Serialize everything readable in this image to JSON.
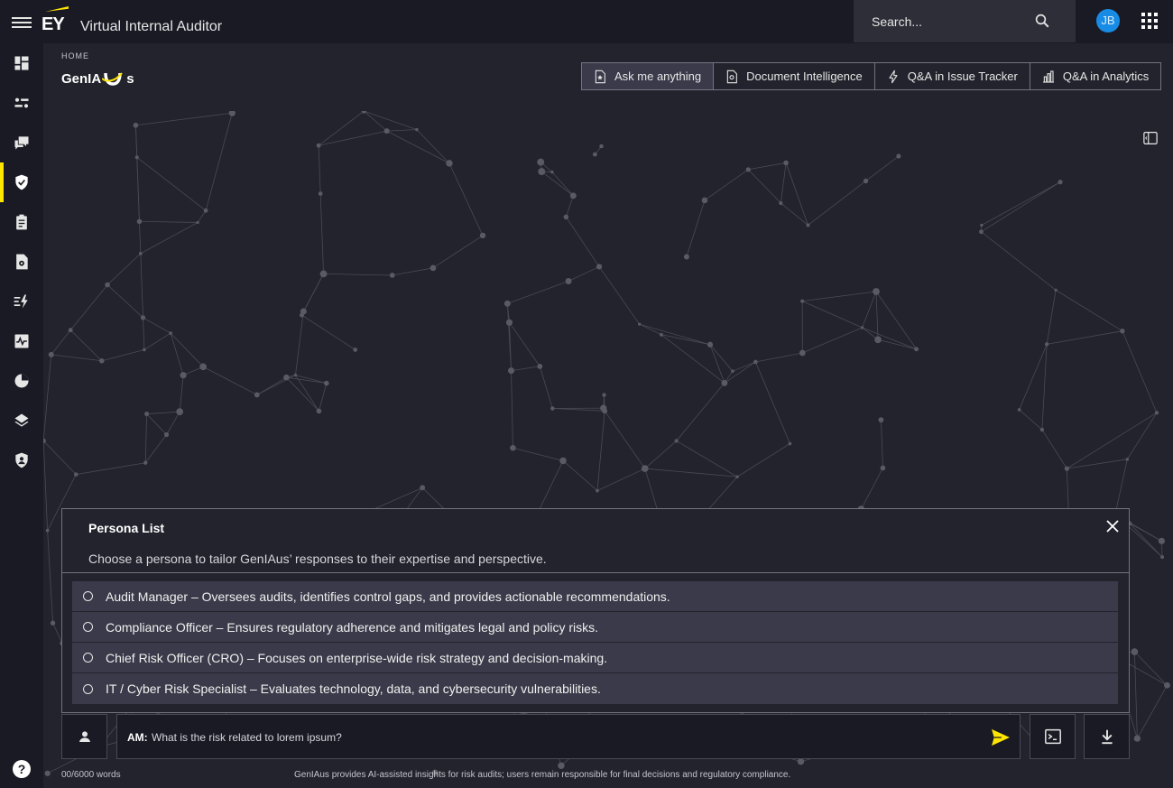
{
  "app": {
    "logo_text": "EY",
    "title": "Virtual Internal Auditor"
  },
  "search": {
    "placeholder": "Search..."
  },
  "user": {
    "initials": "JB"
  },
  "colors": {
    "accent": "#ffe600",
    "avatar": "#188ce5",
    "background": "#23232d",
    "chrome": "#1a1a24"
  },
  "sidebar": {
    "items": [
      {
        "icon": "dashboard-icon"
      },
      {
        "icon": "workflow-icon"
      },
      {
        "icon": "chat-icon"
      },
      {
        "icon": "shield-check-icon",
        "active": true
      },
      {
        "icon": "clipboard-icon"
      },
      {
        "icon": "document-settings-icon"
      },
      {
        "icon": "lightning-list-icon"
      },
      {
        "icon": "pulse-icon"
      },
      {
        "icon": "pie-chart-icon"
      },
      {
        "icon": "layers-icon"
      },
      {
        "icon": "shield-user-icon"
      }
    ],
    "help_label": "?"
  },
  "header": {
    "breadcrumb": "HOME",
    "brand_prefix": "GenIA",
    "brand_suffix": "s"
  },
  "tabs": [
    {
      "label": "Ask me anything",
      "icon": "document-star-icon"
    },
    {
      "label": "Document Intelligence",
      "icon": "document-gear-icon"
    },
    {
      "label": "Q&A in Issue Tracker",
      "icon": "lightning-icon"
    },
    {
      "label": "Q&A in Analytics",
      "icon": "bar-chart-icon"
    }
  ],
  "persona": {
    "title": "Persona List",
    "description": "Choose a persona to tailor GenIAus’ responses to their expertise and perspective.",
    "items": [
      "Audit Manager – Oversees audits, identifies control gaps, and provides actionable recommendations.",
      "Compliance Officer – Ensures regulatory adherence and mitigates legal and policy risks.",
      "Chief Risk Officer (CRO) – Focuses on enterprise-wide risk strategy and decision-making.",
      "IT / Cyber Risk Specialist – Evaluates technology, data, and cybersecurity vulnerabilities."
    ]
  },
  "prompt": {
    "prefix": "AM:",
    "text": "What is the risk related to lorem ipsum?"
  },
  "footer": {
    "word_count": "00/6000 words",
    "disclaimer": "GenIAus provides AI-assisted insights for risk audits; users remain responsible for final decisions and regulatory compliance."
  }
}
